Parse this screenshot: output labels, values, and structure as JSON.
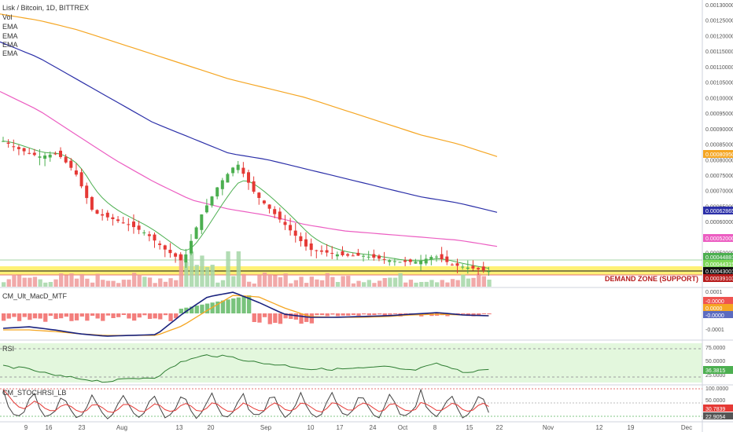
{
  "header": {
    "symbol": "Lisk / Bitcoin, 1D, BITTREX",
    "indicators": [
      "Vol",
      "EMA",
      "EMA",
      "EMA",
      "EMA"
    ]
  },
  "price_axis": {
    "ticks": [
      "0.00130000",
      "0.00125000",
      "0.00120000",
      "0.00115000",
      "0.00110000",
      "0.00105000",
      "0.00100000",
      "0.00095000",
      "0.00090000",
      "0.00085000",
      "0.00080000",
      "0.00075000",
      "0.00070000",
      "0.00065000",
      "0.00060000",
      "0.00055000",
      "0.00050000",
      "0.00045000"
    ],
    "badges": [
      {
        "text": "0.00080950",
        "color": "#f5a623"
      },
      {
        "text": "0.00062865",
        "color": "#2b2fa8"
      },
      {
        "text": "0.00052000",
        "color": "#ec5ec2"
      },
      {
        "text": "0.00044881",
        "color": "#4caf50"
      },
      {
        "text": "0.00044315",
        "color": "#7ed957"
      },
      {
        "text": "0.00043001",
        "color": "#111111"
      },
      {
        "text": "0.00039103",
        "color": "#b71c1c"
      }
    ]
  },
  "demand_zone": {
    "label": "DEMAND ZONE (SUPPORT)",
    "color": "#fff176"
  },
  "macd": {
    "title": "CM_Ult_MacD_MTF",
    "ticks": [
      "0.0001",
      "-0.0001"
    ],
    "badges": [
      {
        "text": "-0.0000",
        "color": "#ef5350"
      },
      {
        "text": "0.0000",
        "color": "#f5a623"
      },
      {
        "text": "-0.0000",
        "color": "#5c6bc0"
      }
    ]
  },
  "rsi": {
    "title": "RSI",
    "ticks": [
      "75.0000",
      "50.0000",
      "25.0000"
    ],
    "badge": {
      "text": "36.3815",
      "color": "#4caf50"
    }
  },
  "stoch": {
    "title": "CM_STOCHRSI_LB",
    "ticks": [
      "100.0000",
      "50.0000"
    ],
    "badges": [
      {
        "text": "30.7839",
        "color": "#e53935"
      },
      {
        "text": "22.9054",
        "color": "#555555"
      }
    ]
  },
  "x_axis": {
    "labels": [
      "9",
      "16",
      "23",
      "Aug",
      "13",
      "20",
      "Sep",
      "10",
      "17",
      "24",
      "Oct",
      "8",
      "15",
      "22",
      "Nov",
      "12",
      "19",
      "Dec"
    ]
  },
  "chart_data": {
    "type": "candlestick",
    "title": "Lisk / Bitcoin, 1D, BITTREX",
    "ylim": [
      0.00039,
      0.0013
    ],
    "ema_series": [
      {
        "color": "#f5a623",
        "values": [
          0.00127,
          0.00125,
          0.00122,
          0.00118,
          0.00114,
          0.0011,
          0.00106,
          0.00103,
          0.001,
          0.00096,
          0.00092,
          0.00088,
          0.00085,
          0.00081
        ]
      },
      {
        "color": "#2b2fa8",
        "values": [
          0.00118,
          0.00113,
          0.00106,
          0.00099,
          0.00092,
          0.00087,
          0.00082,
          0.0008,
          0.00077,
          0.00074,
          0.00071,
          0.00068,
          0.00066,
          0.00063
        ]
      },
      {
        "color": "#ec5ec2",
        "values": [
          0.00102,
          0.00096,
          0.00088,
          0.0008,
          0.00073,
          0.00067,
          0.00064,
          0.00062,
          0.00059,
          0.00057,
          0.00056,
          0.00055,
          0.00054,
          0.00052
        ]
      }
    ],
    "close_approx": [
      0.00086,
      0.00083,
      0.00081,
      0.00082,
      0.00076,
      0.00063,
      0.00061,
      0.00059,
      0.00056,
      0.00051,
      0.00047,
      0.00062,
      0.00072,
      0.00079,
      0.00069,
      0.00063,
      0.00057,
      0.00051,
      0.0005,
      0.00049,
      0.00049,
      0.00048,
      0.00047,
      0.00047,
      0.00049,
      0.00046,
      0.00045,
      0.00044
    ],
    "rsi_last": 36.3815,
    "stoch_last": [
      30.7839,
      22.9054
    ]
  }
}
